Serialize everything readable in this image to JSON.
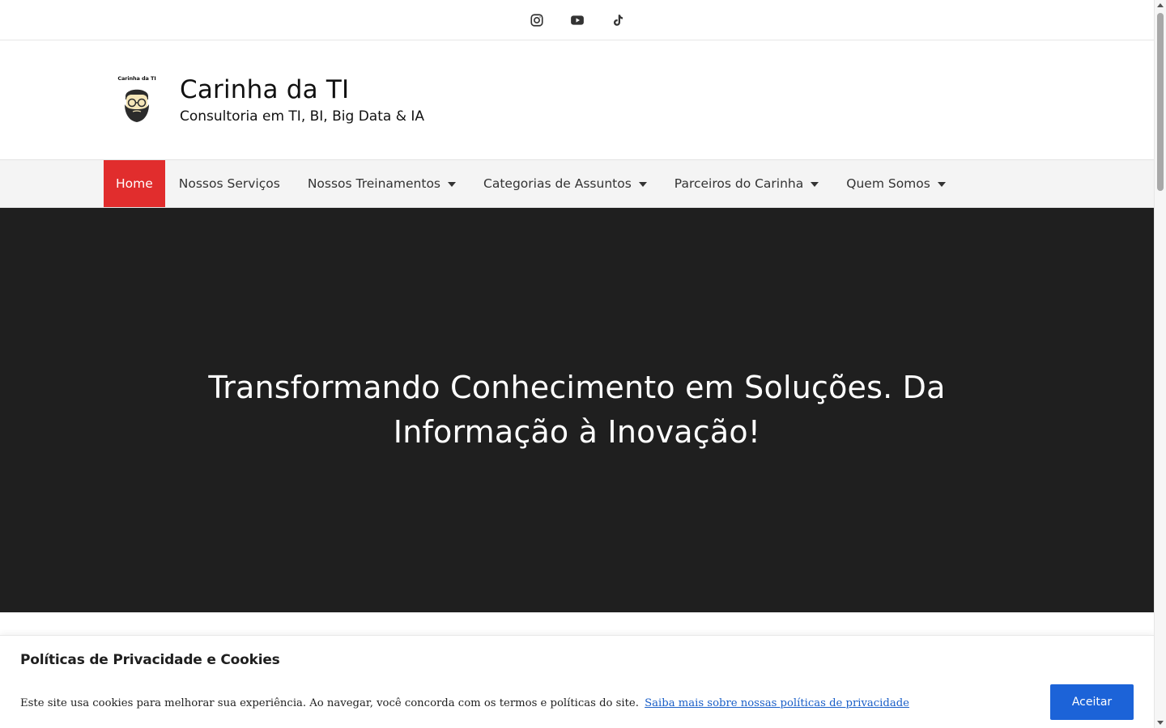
{
  "social": {
    "items": [
      {
        "icon": "instagram-icon"
      },
      {
        "icon": "youtube-icon"
      },
      {
        "icon": "tiktok-icon"
      }
    ]
  },
  "header": {
    "logo_caption": "Carinha da TI",
    "title": "Carinha da TI",
    "tagline": "Consultoria em TI, BI, Big Data & IA"
  },
  "nav": {
    "items": [
      {
        "label": "Home",
        "active": true,
        "has_dropdown": false
      },
      {
        "label": "Nossos Serviços",
        "active": false,
        "has_dropdown": false
      },
      {
        "label": "Nossos Treinamentos",
        "active": false,
        "has_dropdown": true
      },
      {
        "label": "Categorias de Assuntos",
        "active": false,
        "has_dropdown": true
      },
      {
        "label": "Parceiros do Carinha",
        "active": false,
        "has_dropdown": true
      },
      {
        "label": "Quem Somos",
        "active": false,
        "has_dropdown": true
      }
    ]
  },
  "hero": {
    "title": "Transformando Conhecimento em Soluções. Da Informação à Inovação!"
  },
  "cookie": {
    "title": "Políticas de Privacidade e Cookies",
    "text": "Este site usa cookies para melhorar sua experiência. Ao navegar, você concorda com os termos e políticas do site.",
    "link_label": "Saiba mais sobre nossas políticas de privacidade",
    "accept_label": "Aceitar"
  },
  "colors": {
    "accent_red": "#e12d2d",
    "hero_bg": "#1f1f1f",
    "button_blue": "#1c63d8",
    "link_blue": "#1a5fc8"
  }
}
